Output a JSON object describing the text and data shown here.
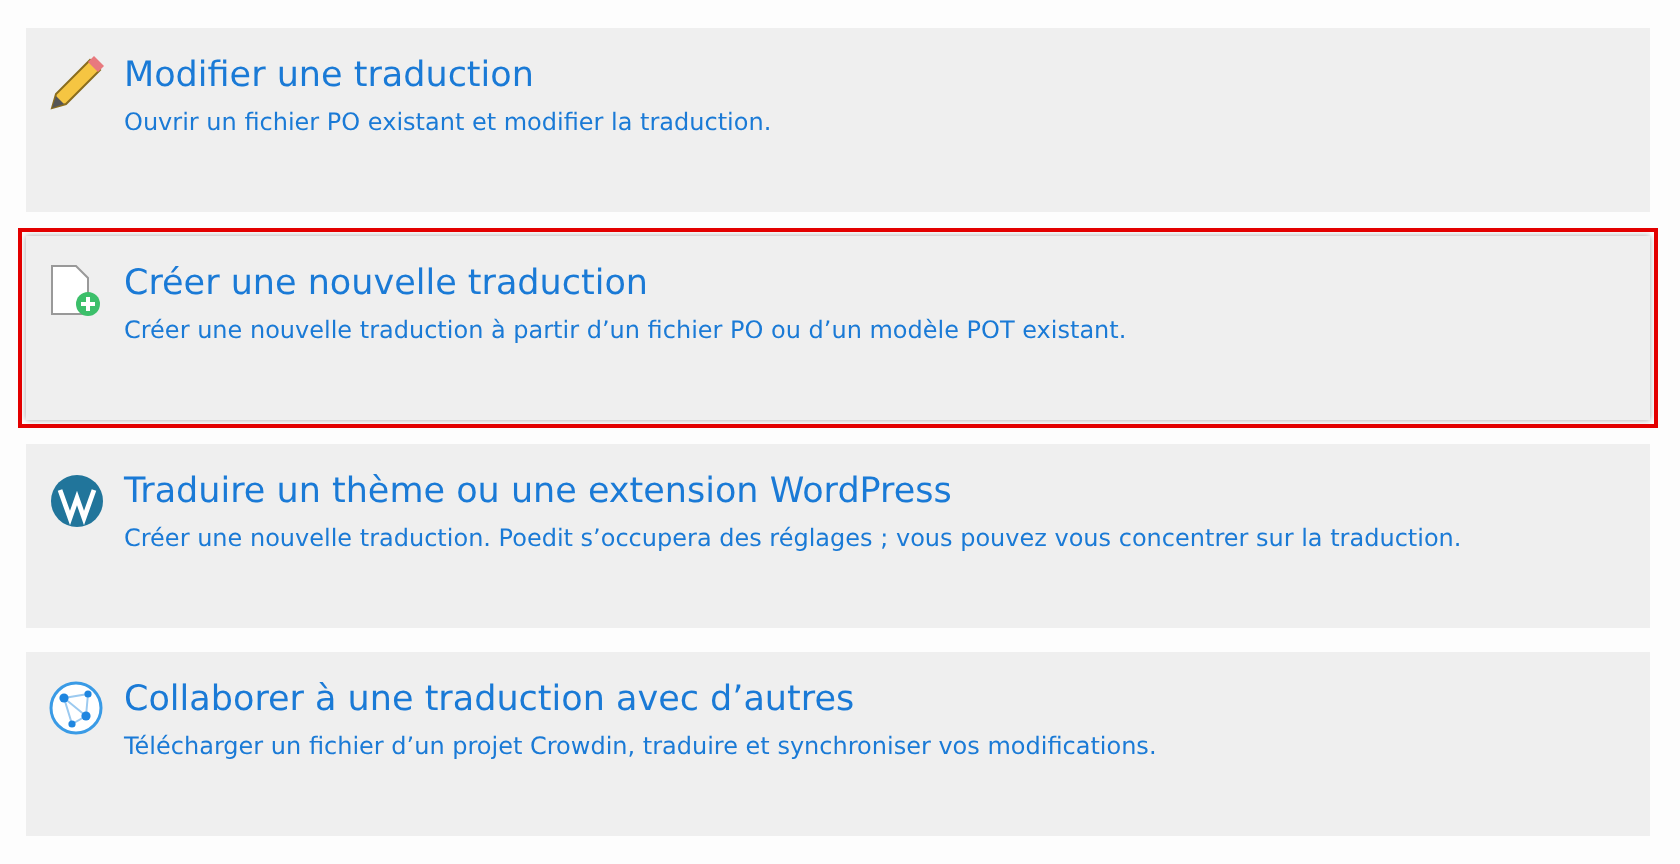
{
  "options": [
    {
      "kind": "pencil",
      "title": "Modifier une traduction",
      "description": "Ouvrir un fichier PO existant et modifier la traduction.",
      "selected": false
    },
    {
      "kind": "new-file",
      "title": "Créer une nouvelle traduction",
      "description": "Créer une nouvelle traduction à partir d’un fichier PO ou d’un modèle POT existant.",
      "selected": true
    },
    {
      "kind": "wordpress",
      "title": "Traduire un thème ou une extension WordPress",
      "description": "Créer une nouvelle traduction. Poedit s’occupera des réglages ; vous pouvez vous concentrer sur la traduction.",
      "selected": false
    },
    {
      "kind": "network",
      "title": "Collaborer à une traduction avec d’autres",
      "description": "Télécharger un fichier d’un projet Crowdin, traduire et synchroniser vos modifications.",
      "selected": false
    }
  ]
}
